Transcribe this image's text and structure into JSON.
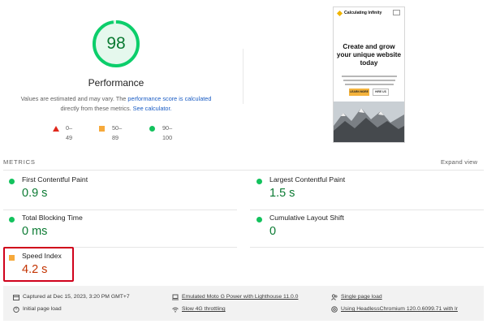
{
  "score": {
    "value": "98",
    "title": "Performance",
    "color": "#0cce6b"
  },
  "description": {
    "prefix": "Values are estimated and may vary. The",
    "link1": "performance score is calculated",
    "middle": "directly from these metrics.",
    "link2": "See calculator."
  },
  "legend": [
    {
      "range": "0–49",
      "shape": "triangle",
      "color": "#e0281c"
    },
    {
      "range": "50–89",
      "shape": "square",
      "color": "#f6a93b"
    },
    {
      "range": "90–100",
      "shape": "circle",
      "color": "#13c25d"
    }
  ],
  "screenshot": {
    "brand": "Calculating Infinity",
    "headline": "Create and grow your unique website today",
    "primary_button": "LEARN MORE",
    "secondary_button": "HIRE US"
  },
  "metrics_header": "METRICS",
  "expand_label": "Expand view",
  "metrics": [
    {
      "label": "First Contentful Paint",
      "value": "0.9 s",
      "status": "good"
    },
    {
      "label": "Largest Contentful Paint",
      "value": "1.5 s",
      "status": "good"
    },
    {
      "label": "Total Blocking Time",
      "value": "0 ms",
      "status": "good"
    },
    {
      "label": "Cumulative Layout Shift",
      "value": "0",
      "status": "good"
    },
    {
      "label": "Speed Index",
      "value": "4.2 s",
      "status": "average"
    }
  ],
  "footer": {
    "captured": "Captured at Dec 15, 2023, 3:20 PM GMT+7",
    "initial_load": "Initial page load",
    "device": "Emulated Moto G Power with Lighthouse 11.0.0",
    "throttling": "Slow 4G throttling",
    "session": "Single page load",
    "browser": "Using HeadlessChromium 120.0.6099.71 with lr"
  }
}
